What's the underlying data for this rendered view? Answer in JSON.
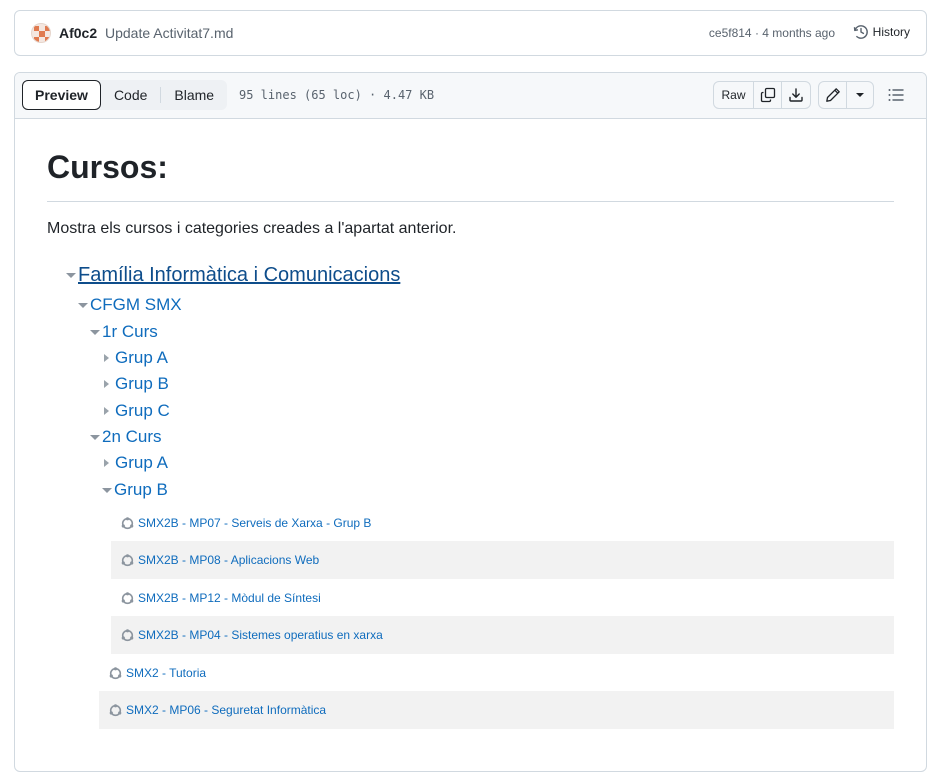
{
  "commit": {
    "user": "Af0c2",
    "message": "Update Activitat7.md",
    "hash": "ce5f814",
    "separator": "·",
    "time": "4 months ago",
    "history_label": "History"
  },
  "file_header": {
    "tabs": [
      {
        "label": "Preview",
        "active": true
      },
      {
        "label": "Code",
        "active": false
      },
      {
        "label": "Blame",
        "active": false
      }
    ],
    "info": "95 lines (65 loc) · 4.47 KB",
    "raw_label": "Raw",
    "icons": [
      "copy-icon",
      "download-icon",
      "pencil-icon",
      "triangle-down-icon",
      "list-unordered-icon"
    ]
  },
  "doc": {
    "heading": "Cursos:",
    "intro": "Mostra els cursos i categories creades a l'apartat anterior.",
    "tree": {
      "root": "Família Informàtica i Comunicacions",
      "cfgm": "CFGM SMX",
      "curs1": "1r Curs",
      "curs1_groups": [
        "Grup A",
        "Grup B",
        "Grup C"
      ],
      "curs2": "2n Curs",
      "curs2_group_a": "Grup A",
      "curs2_group_b": "Grup B",
      "grup_b_courses": [
        "SMX2B - MP07 - Serveis de Xarxa - Grup B",
        "SMX2B - MP08 - Aplicacions Web",
        "SMX2B - MP12 - Mòdul de Síntesi",
        "SMX2B - MP04 - Sistemes operatius en xarxa"
      ],
      "curs2_courses": [
        "SMX2 - Tutoria",
        "SMX2 - MP06 - Seguretat Informàtica"
      ]
    }
  },
  "colors": {
    "link": "#0f6cbd",
    "root_link": "#0e4d8b",
    "border": "#d1d9e0",
    "shaded_row": "#f2f2f2"
  }
}
